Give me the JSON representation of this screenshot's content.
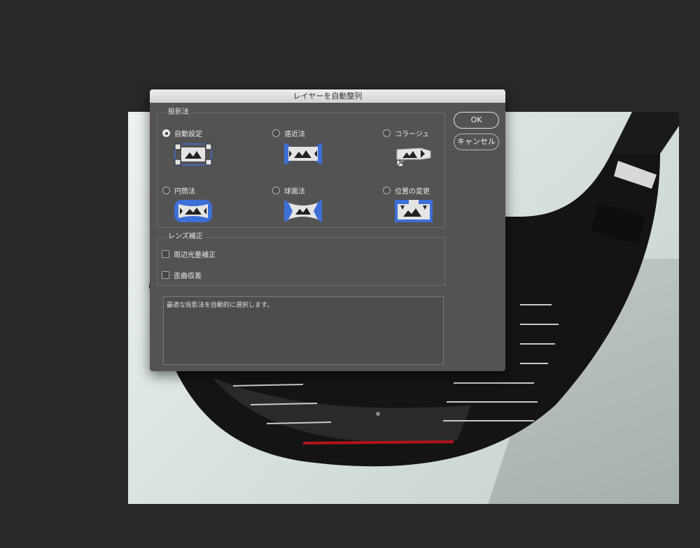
{
  "dialog": {
    "title": "レイヤーを自動整列",
    "projection": {
      "legend": "投影法",
      "options": [
        {
          "label": "自動設定",
          "selected": true,
          "icon": "auto-layout-icon"
        },
        {
          "label": "遠近法",
          "selected": false,
          "icon": "perspective-icon"
        },
        {
          "label": "コラージュ",
          "selected": false,
          "icon": "collage-icon"
        },
        {
          "label": "円筒法",
          "selected": false,
          "icon": "cylindrical-icon"
        },
        {
          "label": "球面法",
          "selected": false,
          "icon": "spherical-icon"
        },
        {
          "label": "位置の変更",
          "selected": false,
          "icon": "reposition-icon"
        }
      ]
    },
    "lens": {
      "legend": "レンズ補正",
      "options": [
        {
          "label": "周辺光量補正",
          "checked": false
        },
        {
          "label": "歪曲収差",
          "checked": false
        }
      ]
    },
    "description": "最適な投影法を自動的に選択します。",
    "buttons": {
      "ok": "OK",
      "cancel": "キャンセル"
    }
  },
  "colors": {
    "accent_blue": "#3d6fd8",
    "dialog_bg": "#535353",
    "app_bg": "#282828"
  }
}
